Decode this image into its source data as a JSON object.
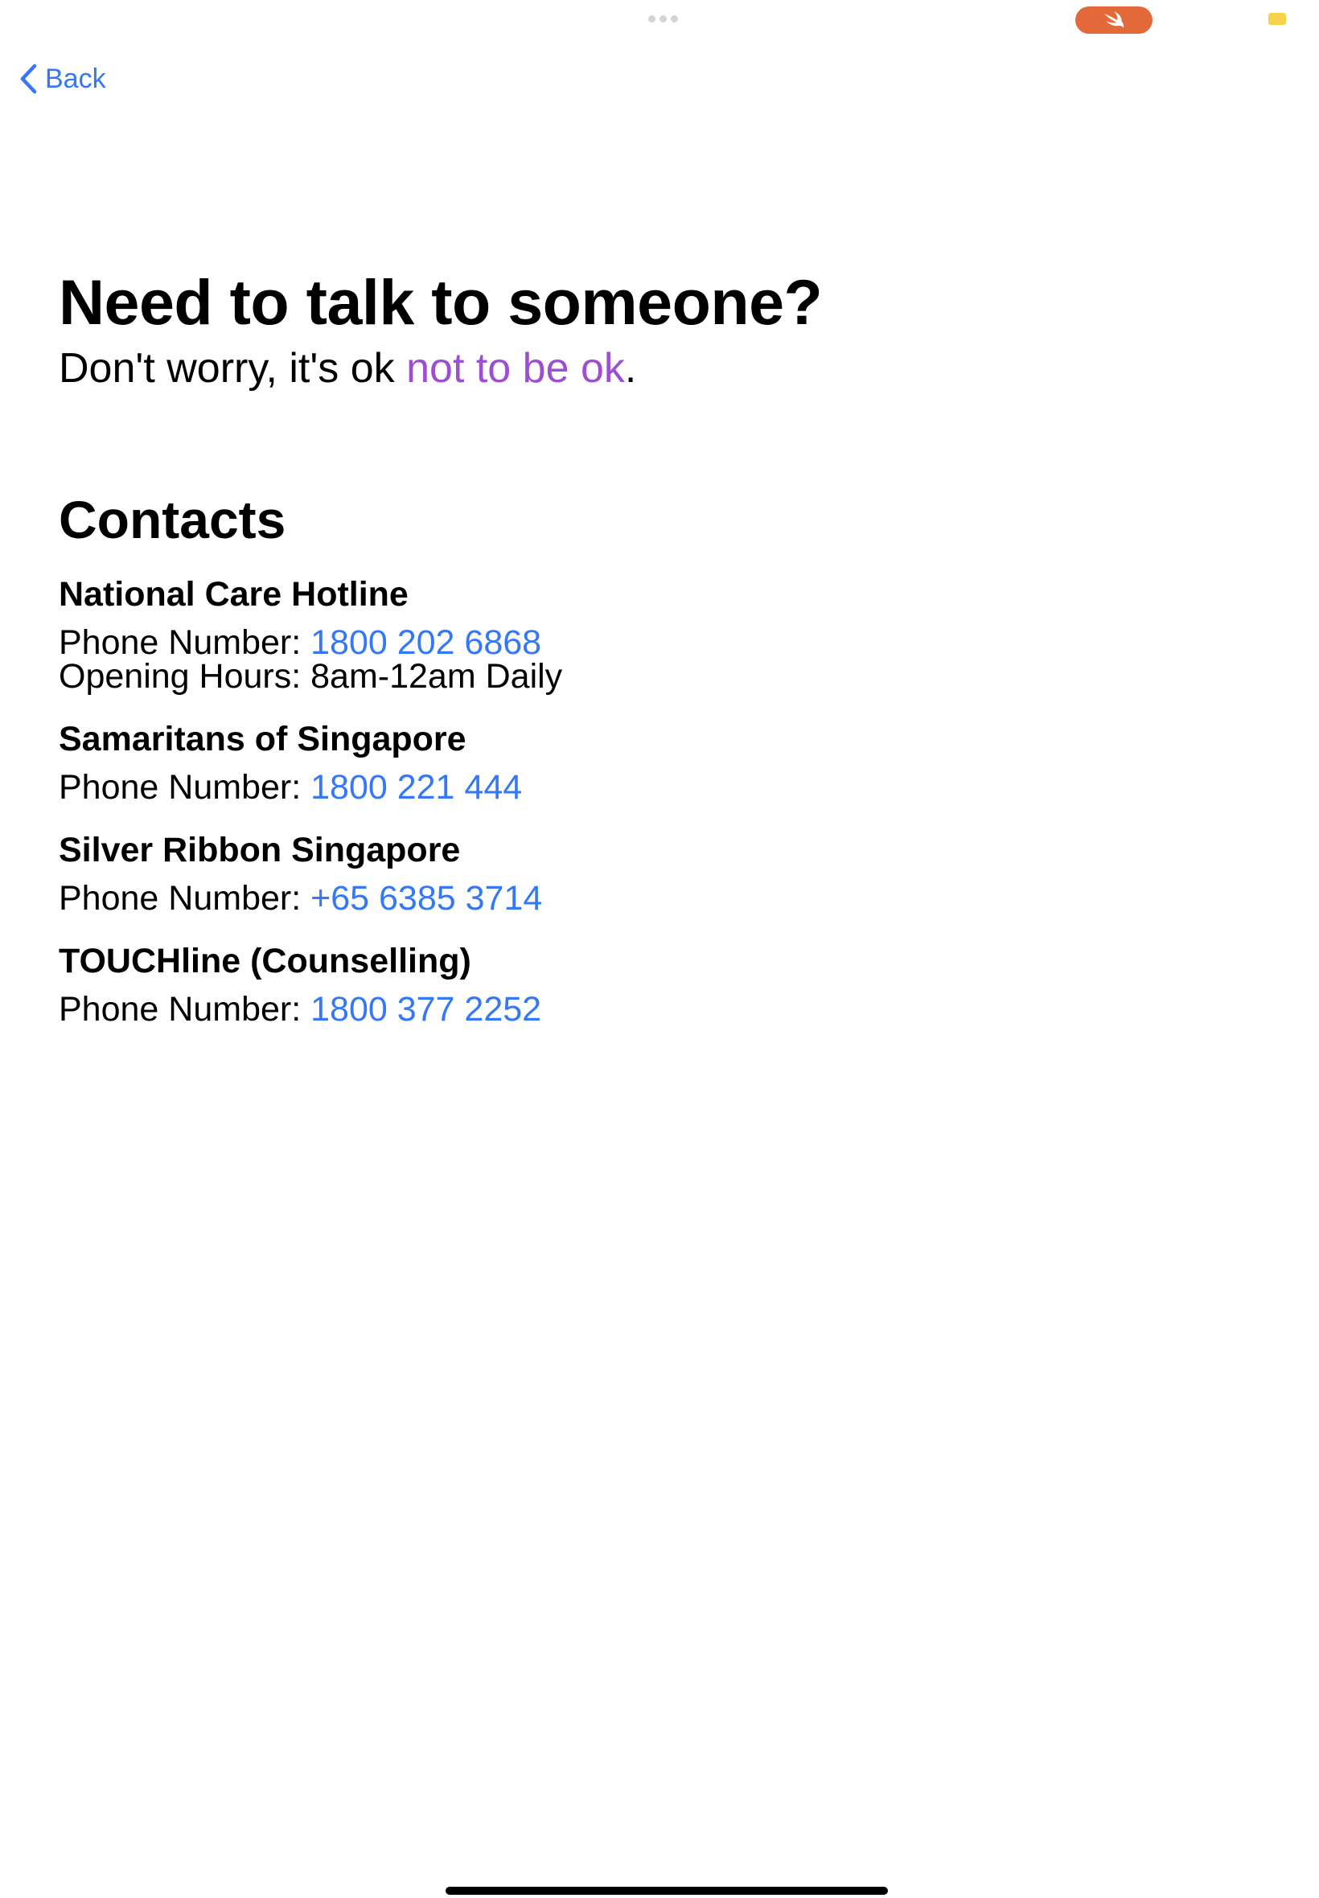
{
  "colors": {
    "link_blue": "#3478f6",
    "accent_purple": "#9d4fd2",
    "swift_orange": "#e3683a",
    "battery_yellow": "#f7d34a",
    "text": "#000000"
  },
  "status_bar": {
    "app_badge_icon": "swift-logo-icon",
    "battery_icon": "battery-icon"
  },
  "nav": {
    "back_label": "Back",
    "back_icon": "chevron-left-icon"
  },
  "header": {
    "title": "Need to talk to someone?",
    "subtitle_prefix": "Don't worry, it's ok ",
    "subtitle_highlight": "not to be ok",
    "subtitle_suffix": "."
  },
  "contacts_section": {
    "title": "Contacts",
    "phone_label": "Phone Number: ",
    "hours_label": "Opening Hours: ",
    "items": [
      {
        "name": "National Care Hotline",
        "phone": "1800 202 6868",
        "hours": "8am-12am Daily"
      },
      {
        "name": "Samaritans of Singapore",
        "phone": "1800 221 444"
      },
      {
        "name": "Silver Ribbon Singapore",
        "phone": "+65 6385 3714"
      },
      {
        "name": "TOUCHline (Counselling)",
        "phone": "1800 377 2252"
      }
    ]
  }
}
